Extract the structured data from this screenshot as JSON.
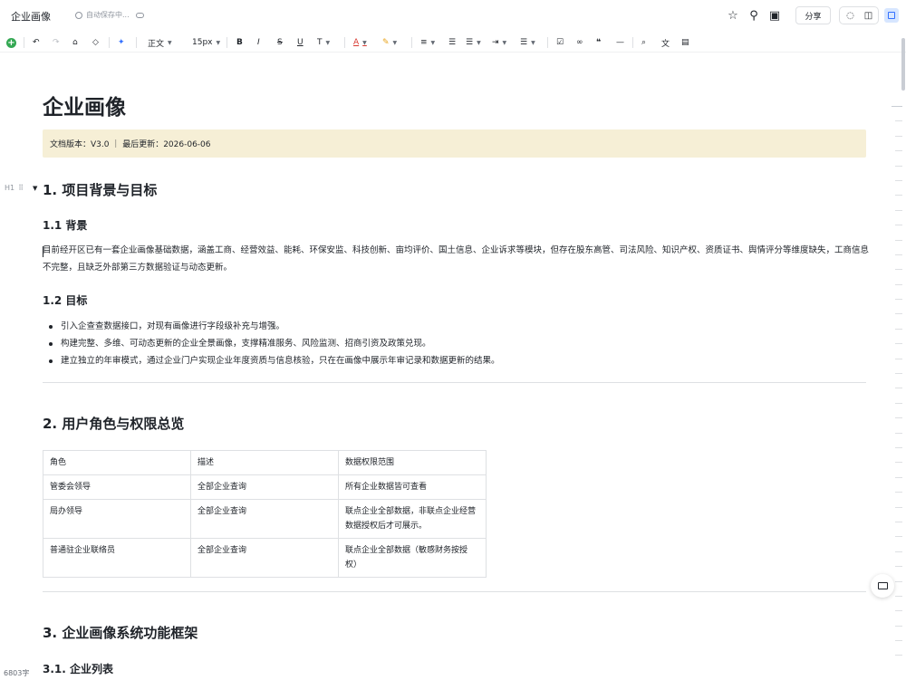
{
  "app": {
    "doc_name": "企业画像",
    "autosave": "自动保存中...",
    "share_label": "分享"
  },
  "toolbar": {
    "paragraph_style": "正文",
    "font_size": "15px"
  },
  "document": {
    "title": "企业画像",
    "callout": "文档版本：V3.0 ｜ 最后更新：2026-06-06",
    "block_handle": "H1",
    "sections": {
      "s1": "1. 项目背景与目标",
      "s1_1": "1.1 背景",
      "s1_1_text": "目前经开区已有一套企业画像基础数据，涵盖工商、经营效益、能耗、环保安监、科技创新、亩均评价、国土信息、企业诉求等模块，但存在股东高管、司法风险、知识产权、资质证书、舆情评分等维度缺失，工商信息不完整，且缺乏外部第三方数据验证与动态更新。",
      "s1_2": "1.2 目标",
      "s1_2_items": [
        "引入企查查数据接口，对现有画像进行字段级补充与增强。",
        "构建完整、多维、可动态更新的企业全景画像，支撑精准服务、风险监测、招商引资及政策兑现。",
        "建立独立的年审模式，通过企业门户实现企业年度资质与信息核验，只在在画像中展示年审记录和数据更新的结果。"
      ],
      "s2": "2. 用户角色与权限总览",
      "s3": "3.  企业画像系统功能框架",
      "s3_1": "3.1. 企业列表"
    },
    "table": {
      "headers": [
        "角色",
        "描述",
        "数据权限范围"
      ],
      "rows": [
        [
          "管委会领导",
          "全部企业查询",
          "所有企业数据皆可查看"
        ],
        [
          "局办领导",
          "全部企业查询",
          "联点企业全部数据，非联点企业经营数据授权后才可展示。"
        ],
        [
          "普通驻企业联络员",
          "全部企业查询",
          "联点企业全部数据（敏感财务按授权）"
        ]
      ]
    }
  },
  "status": {
    "word_count": "6803字"
  }
}
